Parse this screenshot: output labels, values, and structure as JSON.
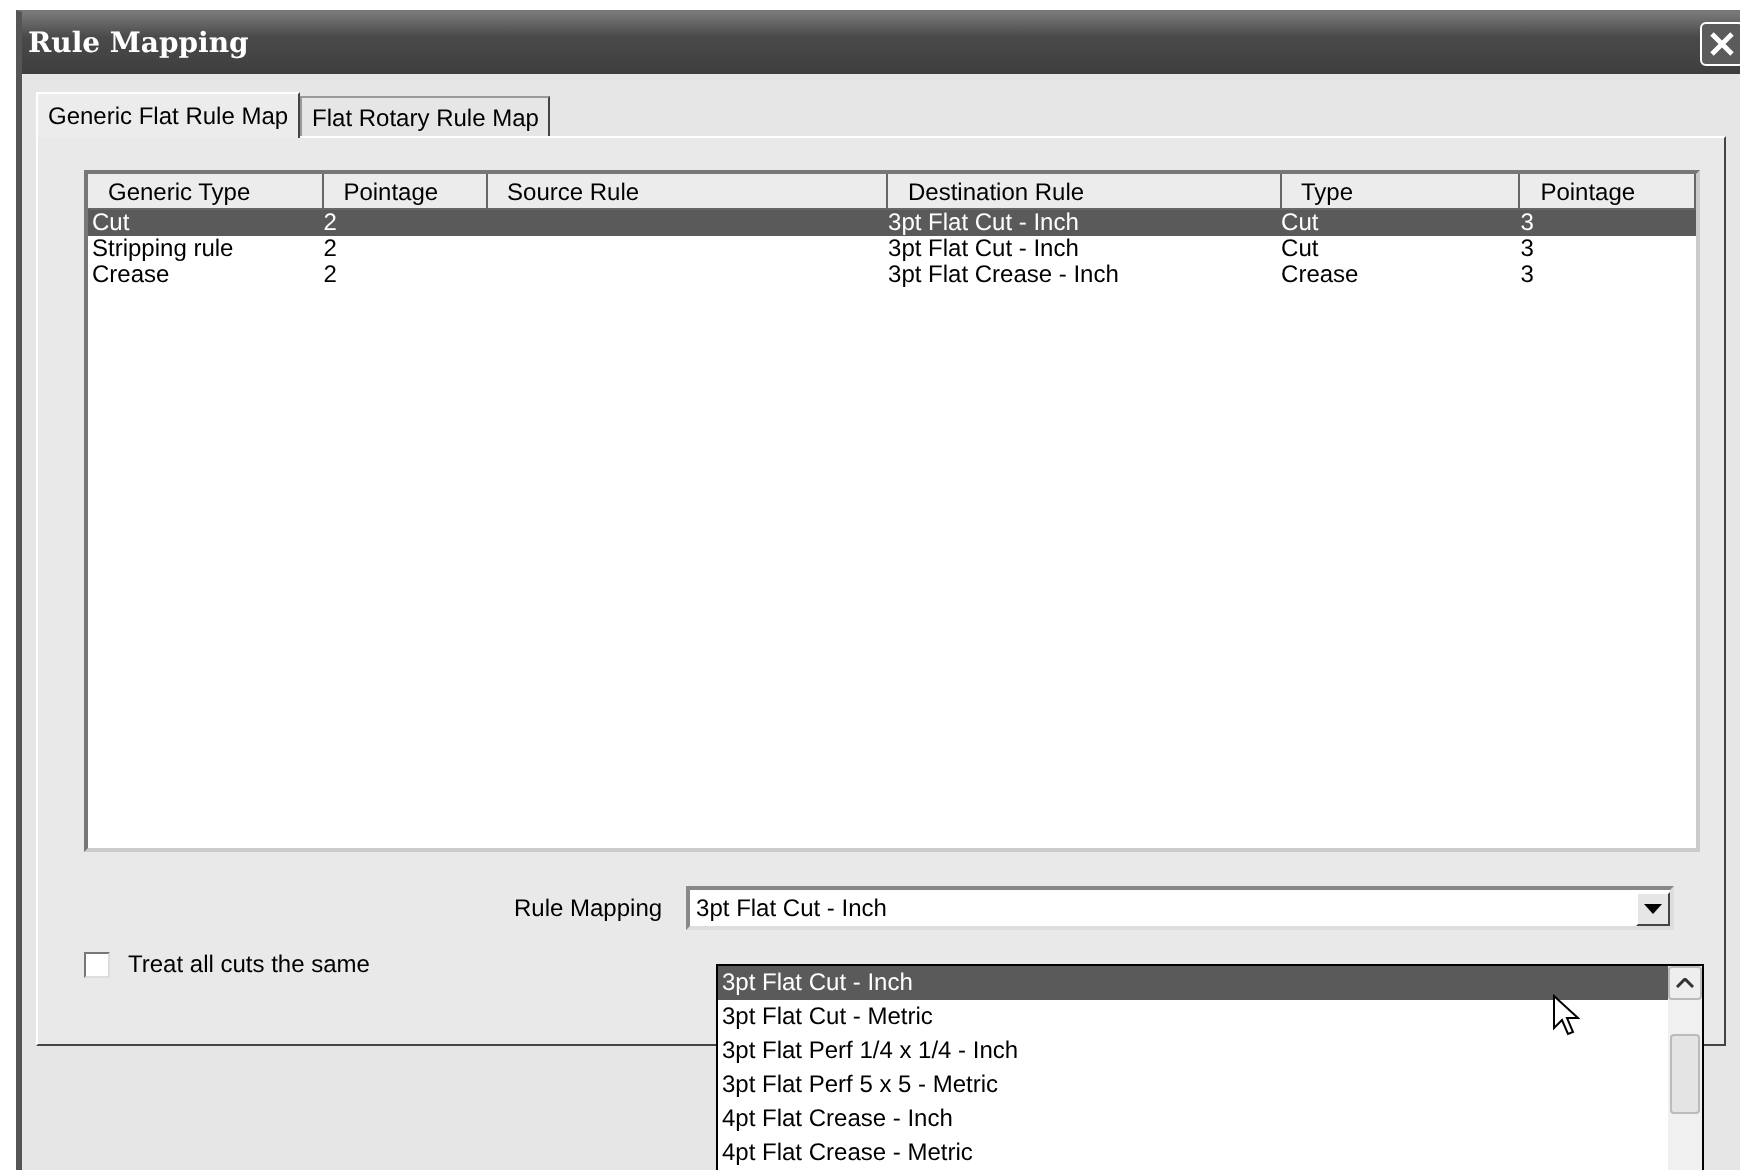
{
  "window": {
    "title": "Rule Mapping"
  },
  "tabs": [
    {
      "label": "Generic Flat Rule Map",
      "selected": true
    },
    {
      "label": "Flat Rotary Rule Map",
      "selected": false
    }
  ],
  "table": {
    "columns": [
      "Generic Type",
      "Pointage",
      "Source Rule",
      "Destination Rule",
      "Type",
      "Pointage"
    ],
    "rows": [
      {
        "cells": [
          "Cut",
          "2",
          "",
          "3pt Flat Cut - Inch",
          "Cut",
          "3"
        ],
        "selected": true
      },
      {
        "cells": [
          "Stripping rule",
          "2",
          "",
          "3pt Flat Cut - Inch",
          "Cut",
          "3"
        ],
        "selected": false
      },
      {
        "cells": [
          "Crease",
          "2",
          "",
          "3pt Flat Crease - Inch",
          "Crease",
          "3"
        ],
        "selected": false
      }
    ]
  },
  "rule_mapping": {
    "label": "Rule Mapping",
    "value": "3pt Flat Cut - Inch",
    "options": [
      {
        "label": "3pt Flat Cut - Inch",
        "selected": true
      },
      {
        "label": "3pt Flat Cut - Metric",
        "selected": false
      },
      {
        "label": "3pt Flat Perf 1/4 x 1/4 - Inch",
        "selected": false
      },
      {
        "label": "3pt Flat Perf 5 x 5 - Metric",
        "selected": false
      },
      {
        "label": "4pt Flat Crease - Inch",
        "selected": false
      },
      {
        "label": "4pt Flat Crease - Metric",
        "selected": false
      }
    ]
  },
  "checkbox": {
    "label": "Treat  all cuts the same",
    "checked": false
  }
}
